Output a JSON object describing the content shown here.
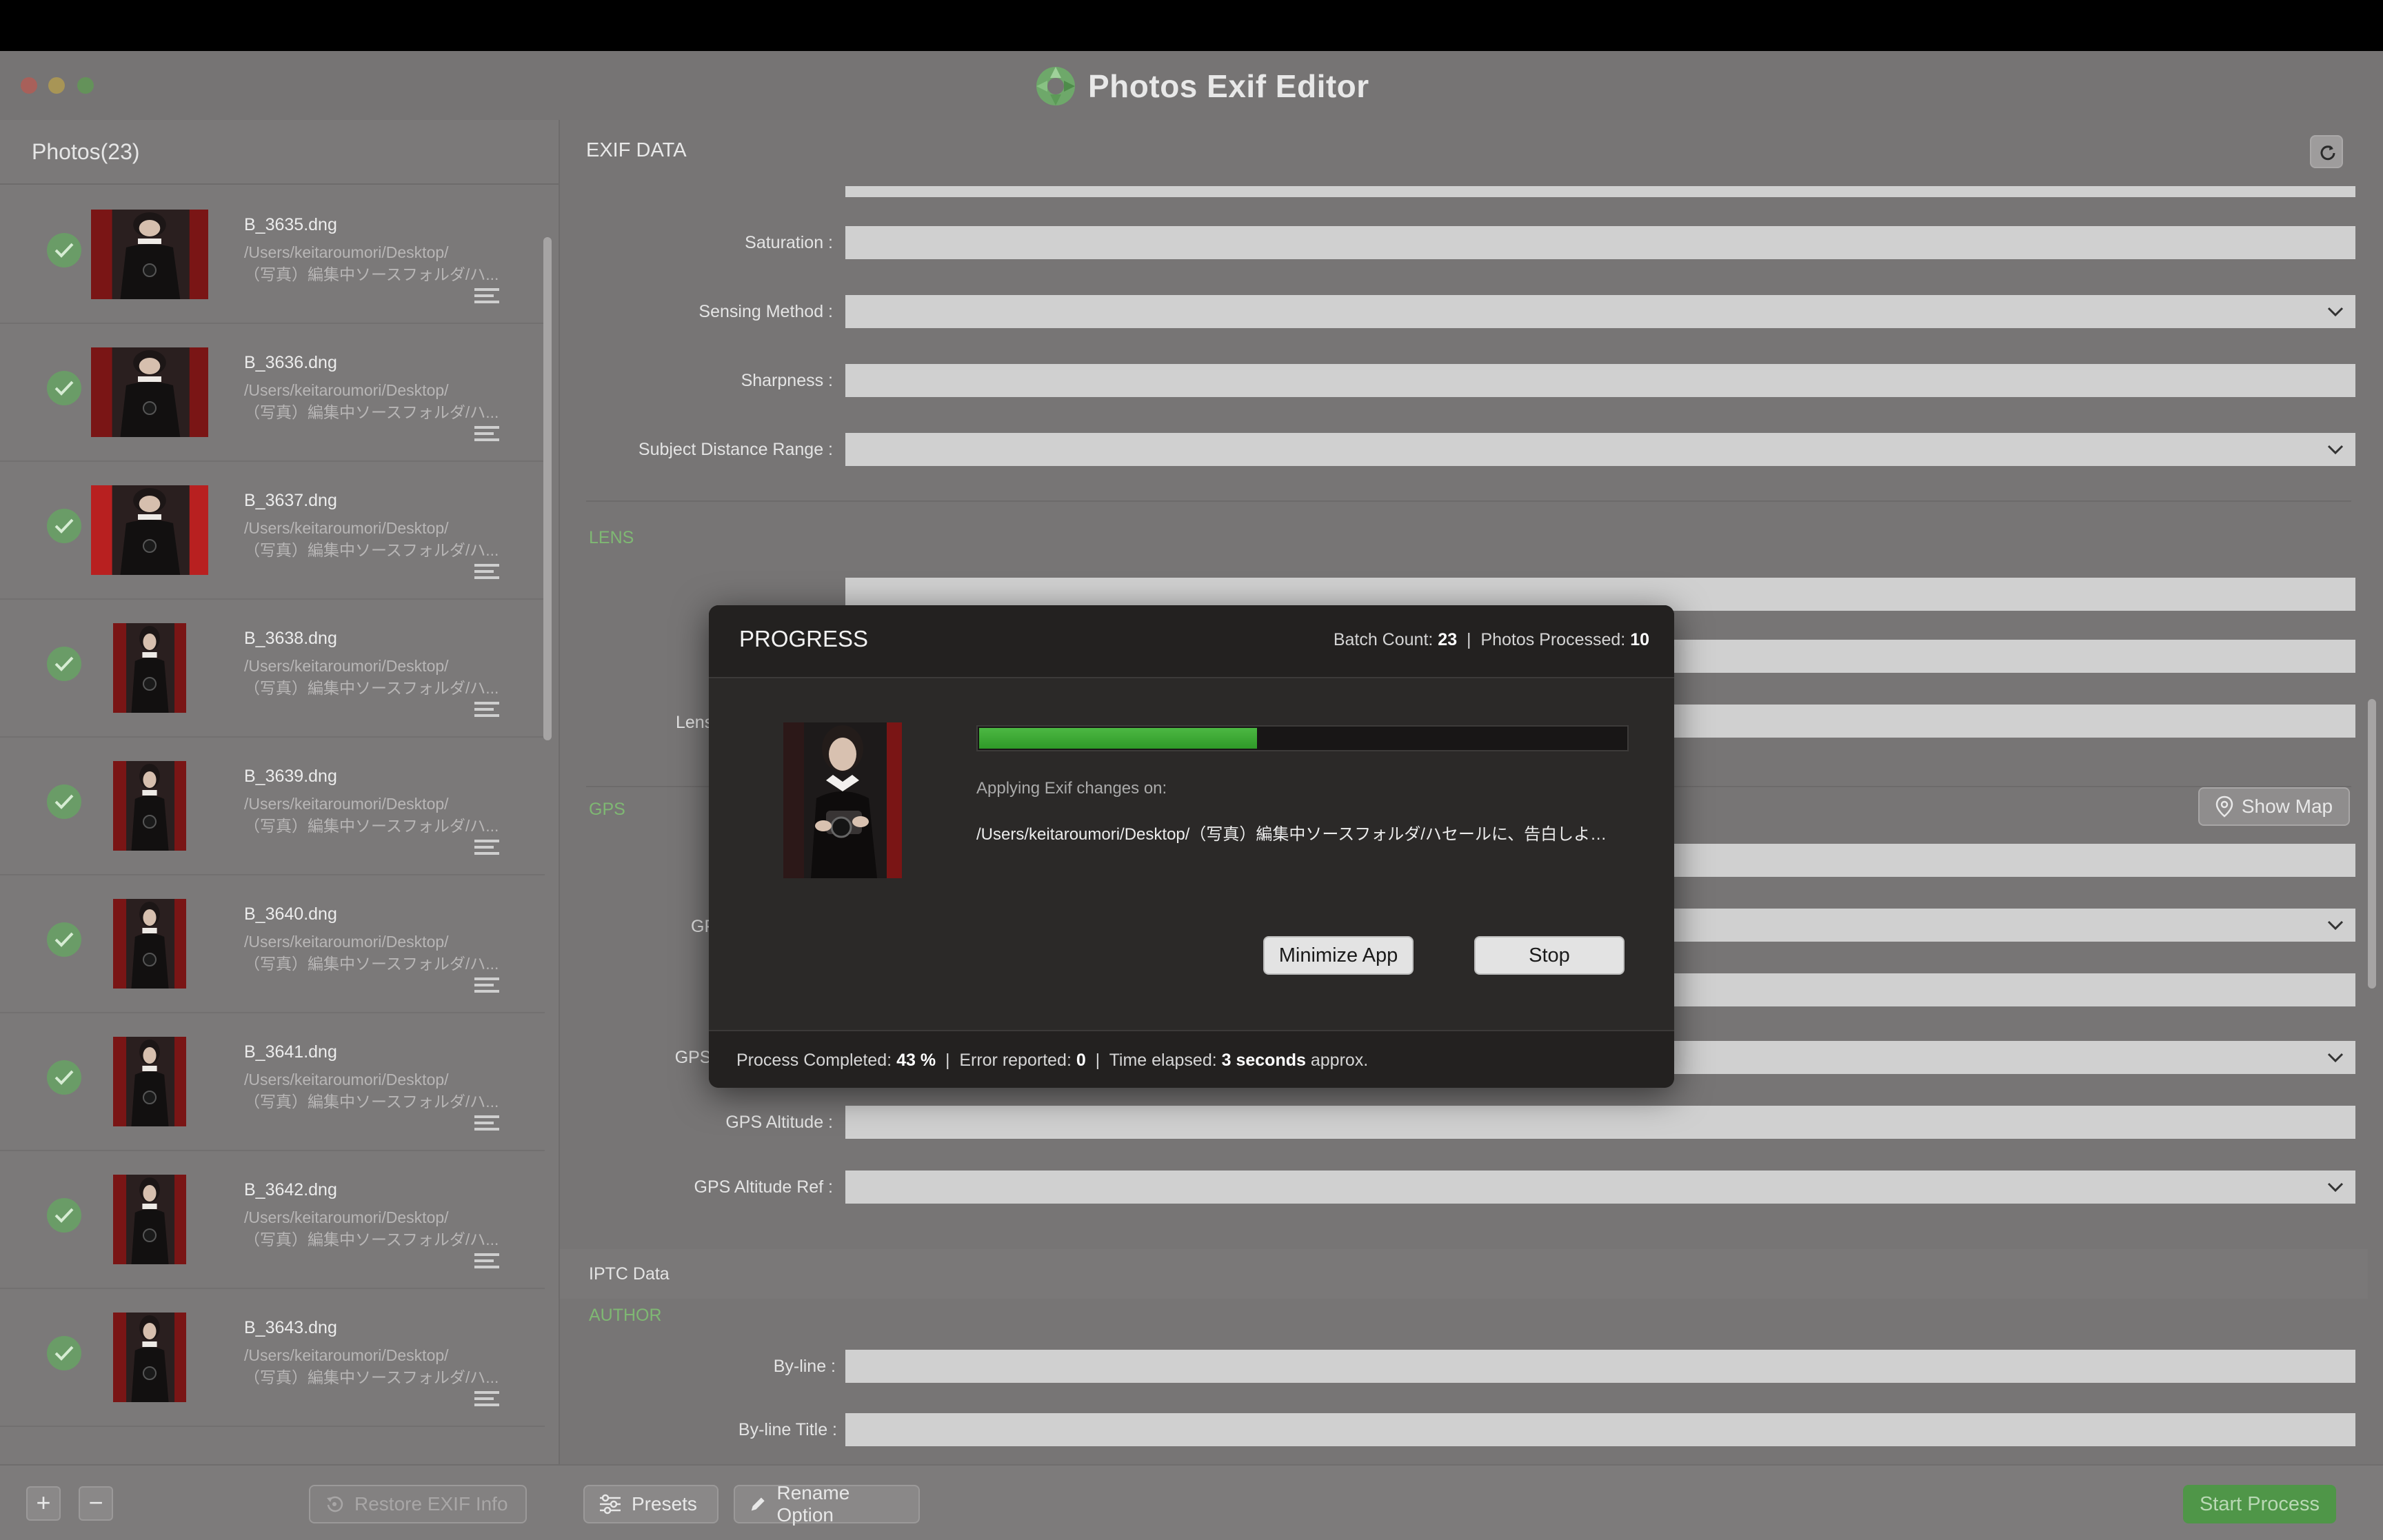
{
  "app": {
    "title": "Photos Exif Editor"
  },
  "sidebar": {
    "title": "Photos(23)",
    "photos": [
      {
        "name": "B_3635.dng",
        "path_line1": "/Users/keitaroumori/Desktop/",
        "path_line2": "（写真）編集中ソースフォルダ/ハ..."
      },
      {
        "name": "B_3636.dng",
        "path_line1": "/Users/keitaroumori/Desktop/",
        "path_line2": "（写真）編集中ソースフォルダ/ハ..."
      },
      {
        "name": "B_3637.dng",
        "path_line1": "/Users/keitaroumori/Desktop/",
        "path_line2": "（写真）編集中ソースフォルダ/ハ..."
      },
      {
        "name": "B_3638.dng",
        "path_line1": "/Users/keitaroumori/Desktop/",
        "path_line2": "（写真）編集中ソースフォルダ/ハ..."
      },
      {
        "name": "B_3639.dng",
        "path_line1": "/Users/keitaroumori/Desktop/",
        "path_line2": "（写真）編集中ソースフォルダ/ハ..."
      },
      {
        "name": "B_3640.dng",
        "path_line1": "/Users/keitaroumori/Desktop/",
        "path_line2": "（写真）編集中ソースフォルダ/ハ..."
      },
      {
        "name": "B_3641.dng",
        "path_line1": "/Users/keitaroumori/Desktop/",
        "path_line2": "（写真）編集中ソースフォルダ/ハ..."
      },
      {
        "name": "B_3642.dng",
        "path_line1": "/Users/keitaroumori/Desktop/",
        "path_line2": "（写真）編集中ソースフォルダ/ハ..."
      },
      {
        "name": "B_3643.dng",
        "path_line1": "/Users/keitaroumori/Desktop/",
        "path_line2": "（写真）編集中ソースフォルダ/ハ..."
      }
    ]
  },
  "main": {
    "title": "EXIF DATA",
    "fields": {
      "saturation": "Saturation :",
      "sensing_method": "Sensing Method :",
      "sharpness": "Sharpness :",
      "subject_distance_range": "Subject Distance Range :",
      "lens_partial": "Lens",
      "gps_partial": "GP",
      "gps_longitude_ref": "GPS Longitude Ref :",
      "gps_altitude": "GPS Altitude :",
      "gps_altitude_ref": "GPS Altitude Ref :",
      "by_line": "By-line :",
      "by_line_title": "By-line Title :"
    },
    "sections": {
      "lens": "LENS",
      "gps": "GPS",
      "iptc": "IPTC Data",
      "author": "AUTHOR"
    },
    "show_map_label": "Show Map"
  },
  "bottombar": {
    "add_label": "+",
    "remove_label": "−",
    "restore_label": "Restore EXIF Info",
    "presets_label": "Presets",
    "rename_label": "Rename Option",
    "start_label": "Start Process"
  },
  "progress": {
    "title": "PROGRESS",
    "batch_count_label": "Batch Count:",
    "batch_count": "23",
    "photos_processed_label": "Photos Processed:",
    "photos_processed": "10",
    "percent_complete": 43,
    "applying_label": "Applying Exif changes on:",
    "applying_path": "/Users/keitaroumori/Desktop/（写真）編集中ソースフォルダ/ハセールに、告白しよ…",
    "minimize_label": "Minimize App",
    "stop_label": "Stop",
    "process_completed_label": "Process Completed:",
    "process_completed": "43 %",
    "error_label": "Error reported:",
    "error_count": "0",
    "time_label": "Time elapsed:",
    "time_value": "3 seconds",
    "time_suffix": "approx."
  },
  "colors": {
    "accent_green": "#4cb843",
    "section_green": "#7fb873",
    "modal_bg": "#2b2928"
  },
  "icons": {
    "check": "check-circle-icon",
    "details": "detail-lines-icon",
    "refresh": "refresh-icon",
    "chevron": "chevron-down-icon",
    "map_pin": "map-pin-icon",
    "presets": "sliders-icon",
    "rename": "pencil-icon",
    "restore": "restore-icon"
  }
}
